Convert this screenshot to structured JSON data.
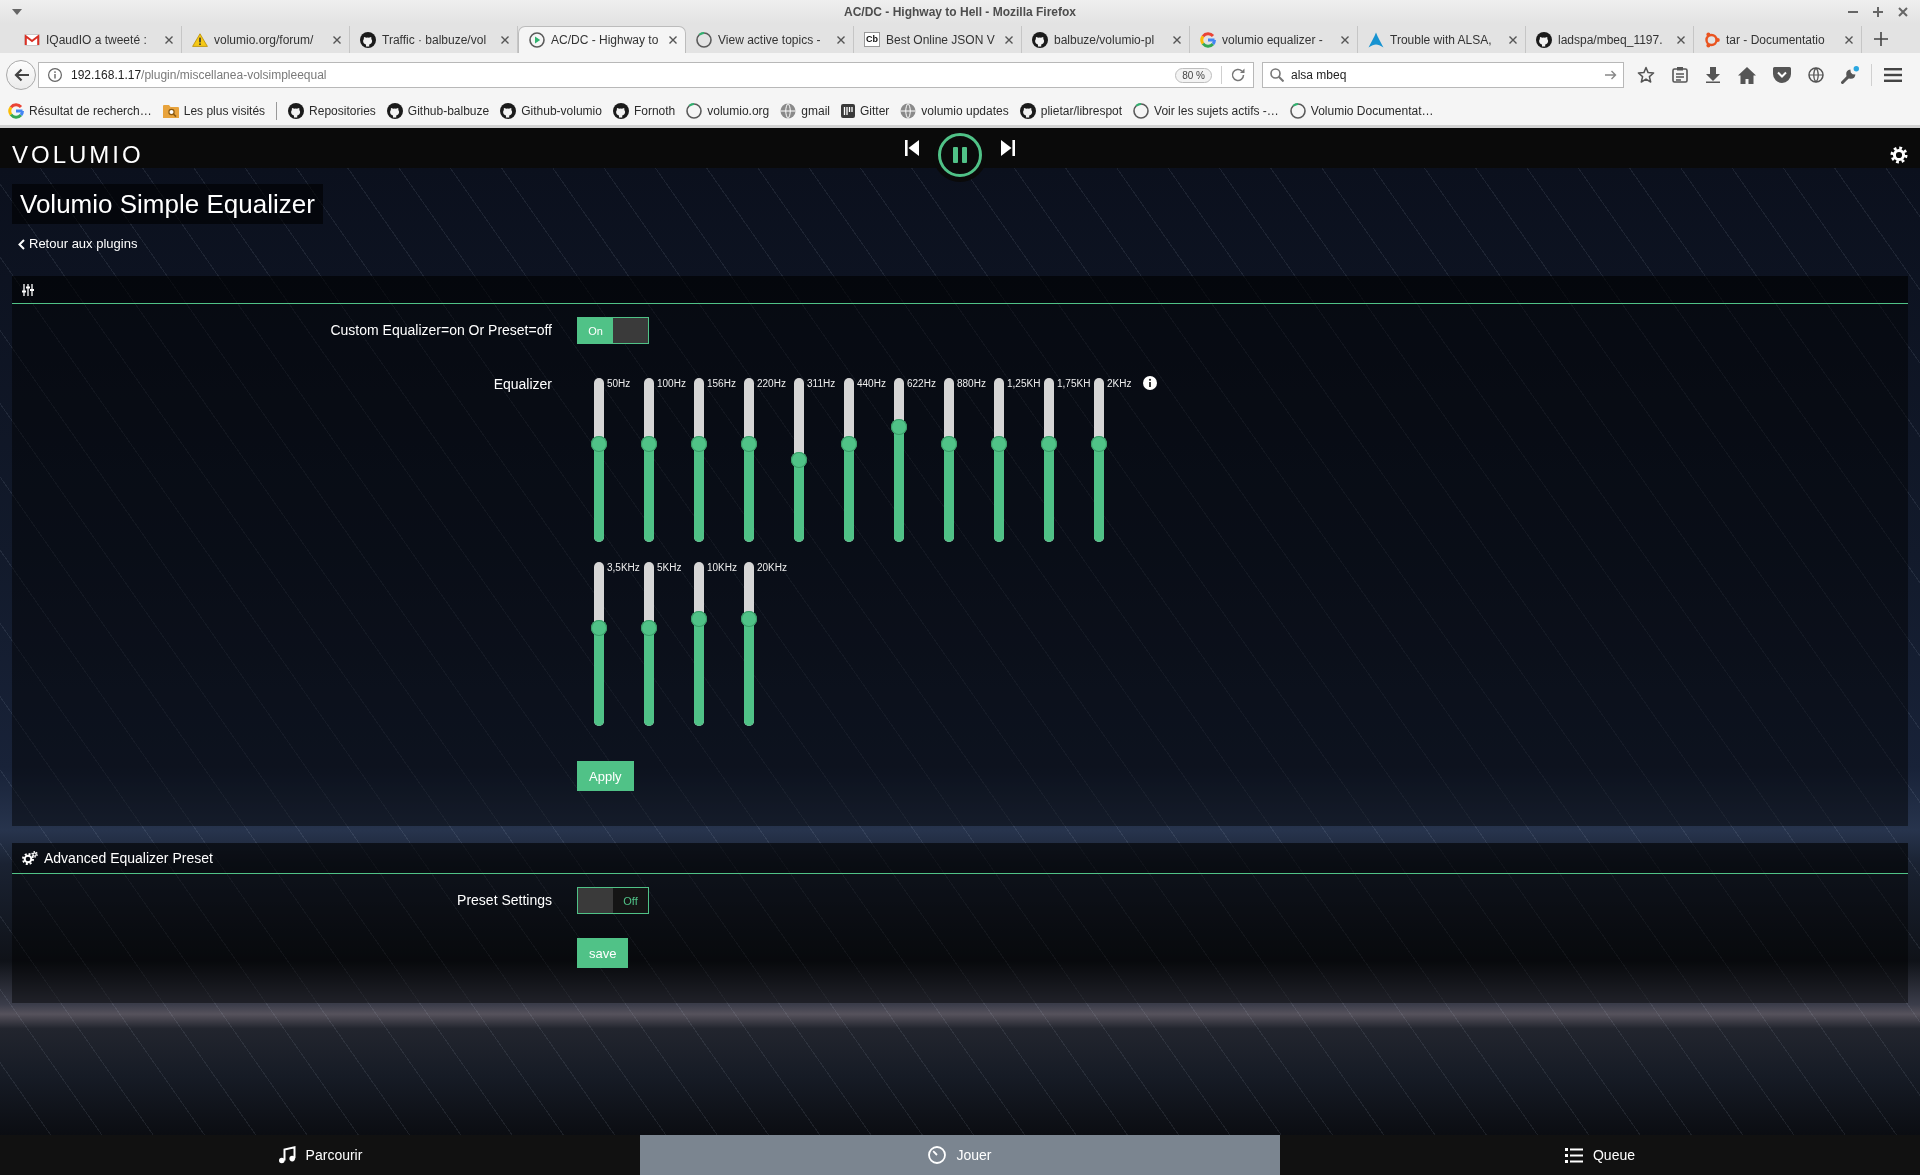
{
  "window": {
    "title": "AC/DC - Highway to Hell - Mozilla Firefox"
  },
  "tabs": [
    {
      "title": "IQaudIO a tweeté :",
      "kind": "envelope",
      "selected": false
    },
    {
      "title": "volumio.org/forum/",
      "kind": "warning",
      "selected": false
    },
    {
      "title": "Traffic · balbuze/vol",
      "kind": "cat",
      "selected": false
    },
    {
      "title": "AC/DC - Highway to",
      "kind": "play-ring",
      "selected": true
    },
    {
      "title": "View active topics -",
      "kind": "ring",
      "selected": false
    },
    {
      "title": "Best Online JSON V",
      "kind": "letters",
      "icon_text": "Cb",
      "selected": false
    },
    {
      "title": "balbuze/volumio-pl",
      "kind": "cat",
      "selected": false
    },
    {
      "title": "volumio equalizer -",
      "kind": "multicolor",
      "selected": false
    },
    {
      "title": "Trouble with ALSA,",
      "kind": "peak",
      "selected": false
    },
    {
      "title": "ladspa/mbeq_1197.",
      "kind": "cat",
      "selected": false
    },
    {
      "title": "tar - Documentatio",
      "kind": "dots",
      "selected": false
    }
  ],
  "navigation": {
    "url_host": "192.168.1.17",
    "url_path": "/plugin/miscellanea-volsimpleequal",
    "zoom": "80 %",
    "search_value": "alsa mbeq"
  },
  "bookmark_groups": [
    [
      {
        "label": "Résultat de recherch…",
        "kind": "multicolor"
      },
      {
        "label": "Les plus visités",
        "kind": "folder"
      }
    ],
    [
      {
        "label": "Repositories",
        "kind": "cat"
      },
      {
        "label": "Github-balbuze",
        "kind": "cat"
      },
      {
        "label": "Github-volumio",
        "kind": "cat"
      },
      {
        "label": "Fornoth",
        "kind": "cat"
      },
      {
        "label": "volumio.org",
        "kind": "ring"
      },
      {
        "label": "gmail",
        "kind": "globe"
      },
      {
        "label": "Gitter",
        "kind": "bars"
      },
      {
        "label": "volumio updates",
        "kind": "globe"
      },
      {
        "label": "plietar/librespot",
        "kind": "cat"
      },
      {
        "label": "Voir les sujets actifs -…",
        "kind": "ring"
      },
      {
        "label": "Volumio Documentat…",
        "kind": "ring"
      }
    ]
  ],
  "volumio": {
    "logo": "VOLUMIO",
    "playing": true
  },
  "page": {
    "title": "Volumio Simple Equalizer",
    "back_link": "Retour aux plugins"
  },
  "sections": [
    {
      "kind": "sliders",
      "rows": [
        {
          "kind": "toggle",
          "label": "Custom Equalizer=on Or Preset=off",
          "on": true,
          "text": "On"
        },
        {
          "kind": "equalizer",
          "label": "Equalizer",
          "bands": [
            {
              "label": "50Hz",
              "level": 0.6
            },
            {
              "label": "100Hz",
              "level": 0.6
            },
            {
              "label": "156Hz",
              "level": 0.6
            },
            {
              "label": "220Hz",
              "level": 0.6
            },
            {
              "label": "311Hz",
              "level": 0.5
            },
            {
              "label": "440Hz",
              "level": 0.6
            },
            {
              "label": "622Hz",
              "level": 0.7
            },
            {
              "label": "880Hz",
              "level": 0.6
            },
            {
              "label": "1,25KH",
              "level": 0.6
            },
            {
              "label": "1,75KH",
              "level": 0.6
            },
            {
              "label": "2KHz",
              "level": 0.6
            },
            {
              "label": "3,5KHz",
              "level": 0.6
            },
            {
              "label": "5KHz",
              "level": 0.6
            },
            {
              "label": "10KHz",
              "level": 0.65
            },
            {
              "label": "20KHz",
              "level": 0.65
            }
          ]
        }
      ],
      "button": "Apply"
    },
    {
      "kind": "gears",
      "title": "Advanced Equalizer Preset",
      "rows": [
        {
          "kind": "toggle",
          "label": "Preset Settings",
          "on": false,
          "text": "Off"
        }
      ],
      "button": "save"
    }
  ],
  "footer_tabs": [
    {
      "label": "Parcourir",
      "kind": "music",
      "selected": false
    },
    {
      "label": "Jouer",
      "kind": "clock",
      "selected": true
    },
    {
      "label": "Queue",
      "kind": "list",
      "selected": false
    }
  ]
}
